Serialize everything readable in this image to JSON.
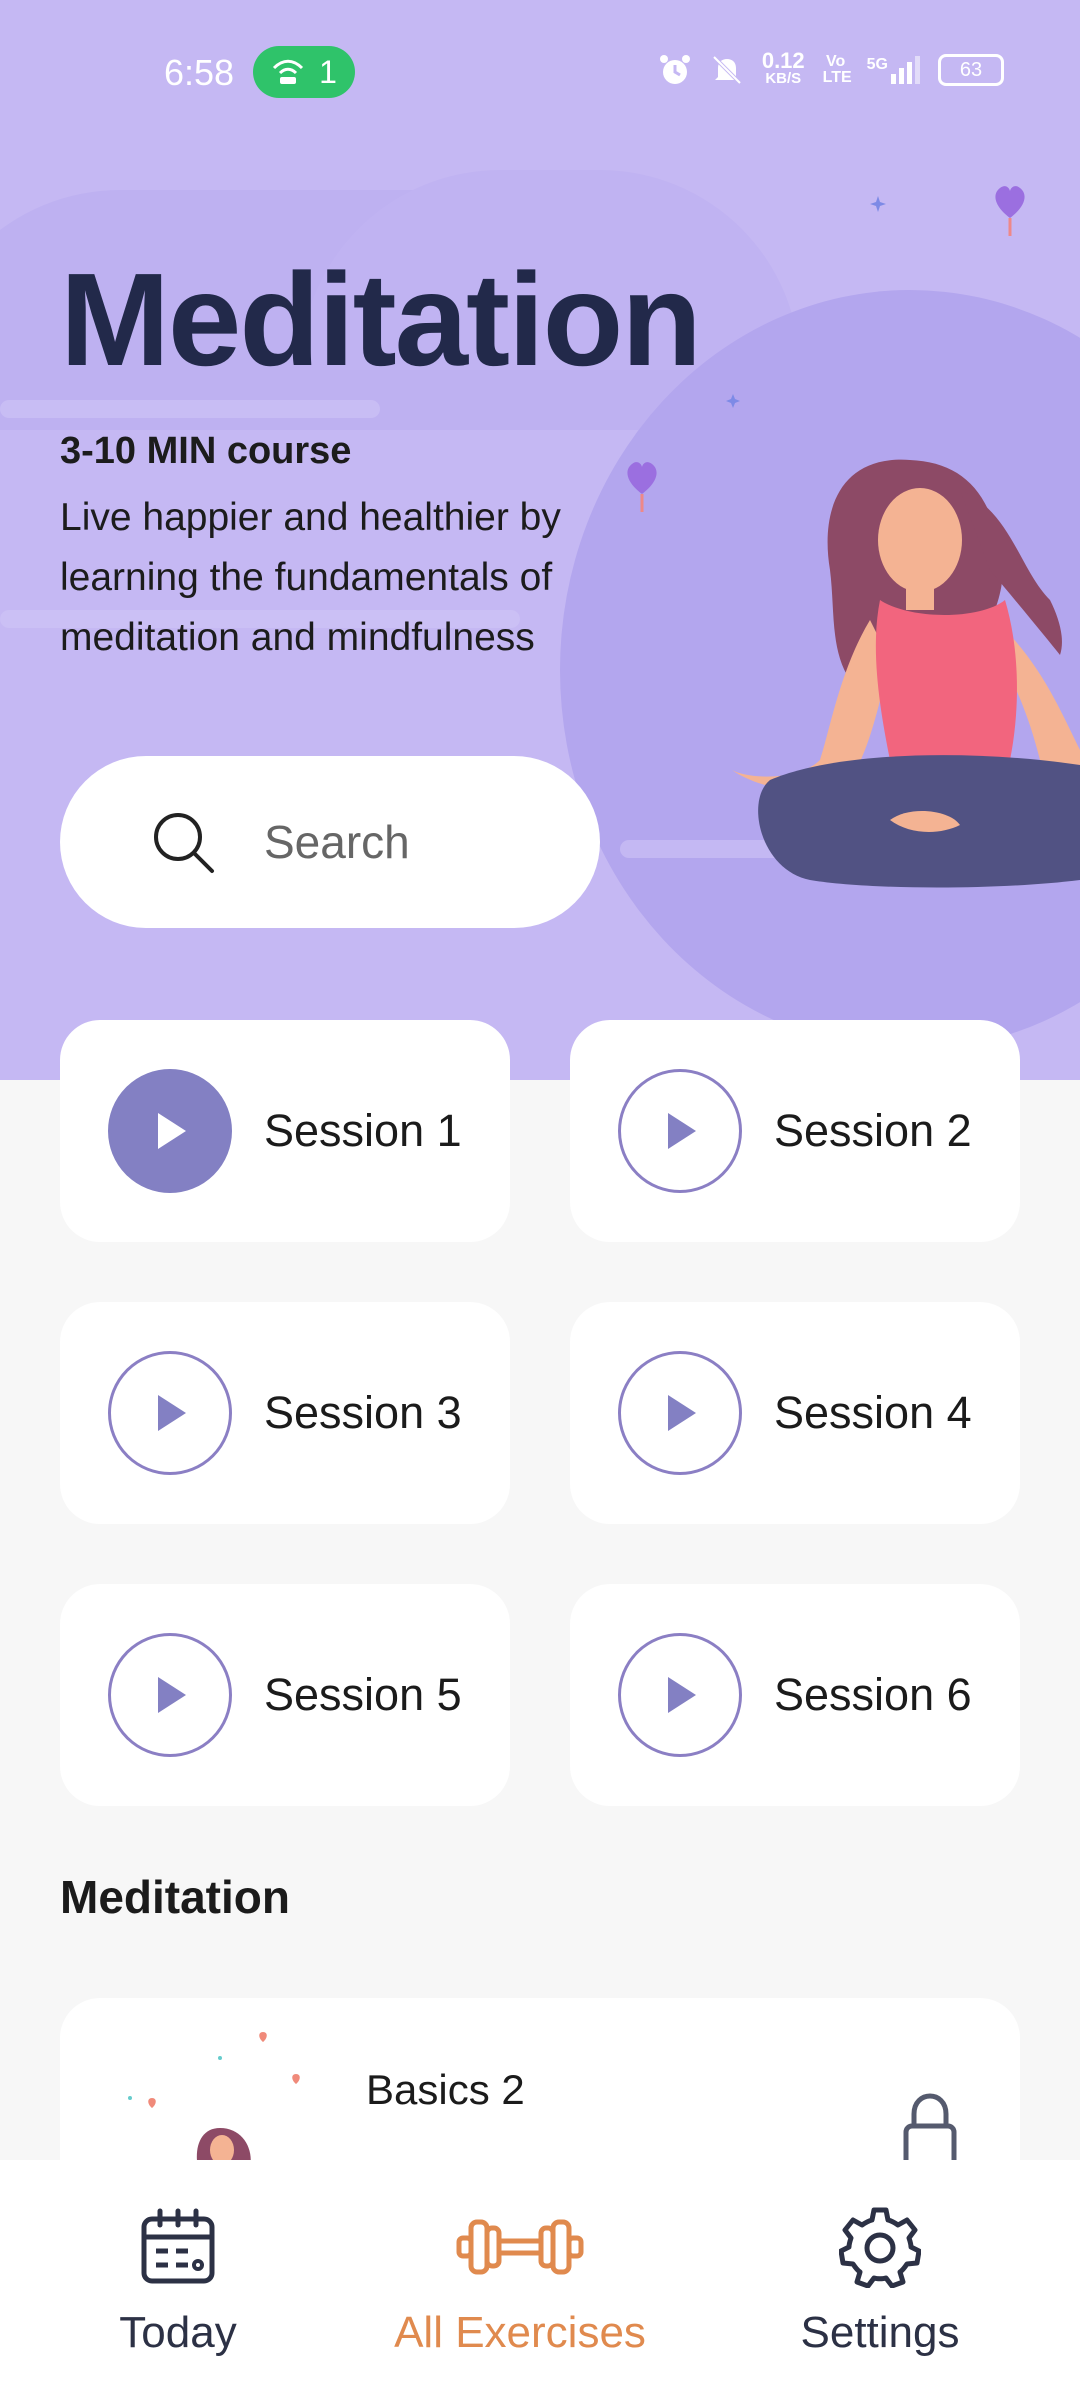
{
  "status_bar": {
    "time": "6:58",
    "hotspot_count": "1",
    "net_speed": "0.12",
    "net_unit": "KB/S",
    "volte": "Vo LTE",
    "network": "5G",
    "battery": "63"
  },
  "hero": {
    "title": "Meditation",
    "subtitle": "3-10 MIN course",
    "description": "Live happier and healthier by learning the fundamentals of meditation and mindfulness",
    "search_label": "Search"
  },
  "sessions": [
    {
      "label": "Session 1",
      "active": true
    },
    {
      "label": "Session 2",
      "active": false
    },
    {
      "label": "Session 3",
      "active": false
    },
    {
      "label": "Session 4",
      "active": false
    },
    {
      "label": "Session 5",
      "active": false
    },
    {
      "label": "Session 6",
      "active": false
    }
  ],
  "section": {
    "title": "Meditation",
    "card_title": "Basics 2",
    "card_icon": "lock-icon"
  },
  "nav": {
    "today": "Today",
    "all_exercises": "All Exercises",
    "settings": "Settings",
    "active": "all_exercises"
  },
  "colors": {
    "hero_bg": "#c5b8f3",
    "title": "#22294a",
    "play_accent": "#8380c3",
    "nav_active": "#e08a4e"
  }
}
